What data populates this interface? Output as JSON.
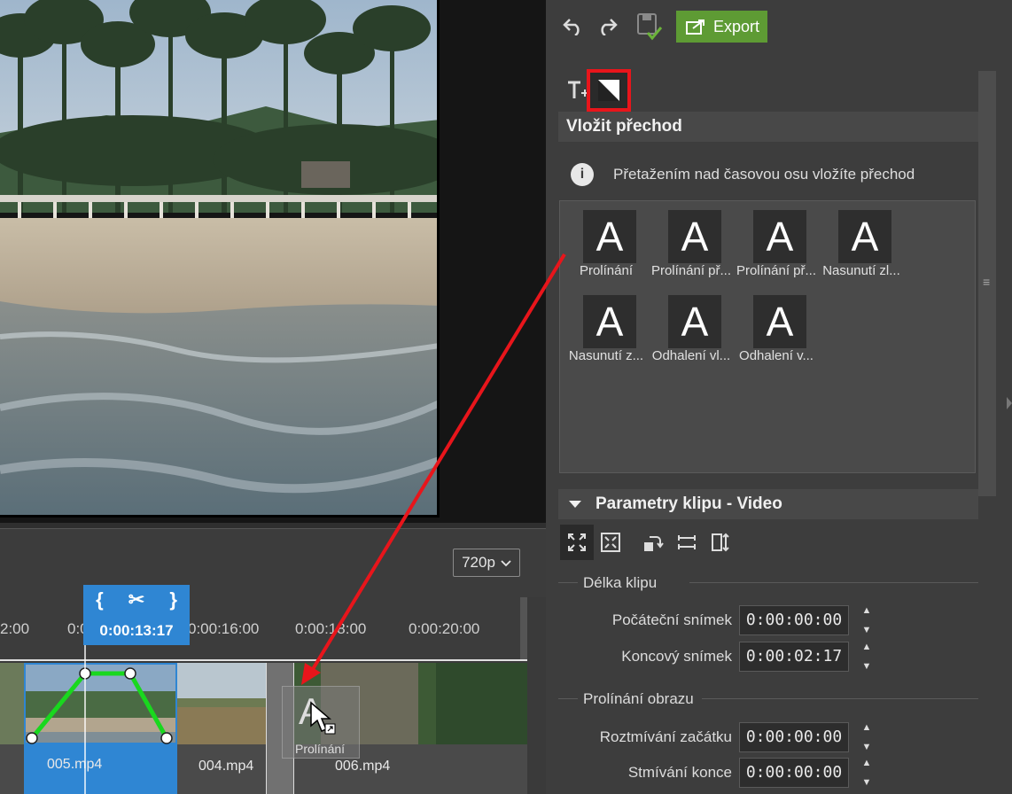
{
  "toolbar": {
    "undo_icon": "undo-icon",
    "redo_icon": "redo-icon",
    "save_icon": "save-check-icon",
    "export_label": "Export"
  },
  "tools": {
    "text_icon": "text-insert-icon",
    "transition_icon": "transition-icon"
  },
  "transitions_panel": {
    "title": "Vložit přechod",
    "info": "Přetažením nad časovou osu vložíte přechod",
    "tiles": [
      {
        "thumb": "A",
        "caption": "Prolínání"
      },
      {
        "thumb": "A",
        "caption": "Prolínání př..."
      },
      {
        "thumb": "A",
        "caption": "Prolínání př..."
      },
      {
        "thumb": "A",
        "caption": "Nasunutí zl..."
      },
      {
        "thumb": "A",
        "caption": "Nasunutí z..."
      },
      {
        "thumb": "A",
        "caption": "Odhalení vl..."
      },
      {
        "thumb": "A",
        "caption": "Odhalení v..."
      }
    ]
  },
  "clip_params": {
    "title": "Parametry klipu - Video",
    "length_section": "Délka klipu",
    "start_label": "Počáteční snímek",
    "start_value": "0:00:00:00",
    "end_label": "Koncový snímek",
    "end_value": "0:00:02:17",
    "blend_section": "Prolínání obrazu",
    "fade_in_label": "Roztmívání začátku",
    "fade_in_value": "0:00:00:00",
    "fade_out_label": "Stmívání konce",
    "fade_out_value": "0:00:00:00"
  },
  "timeline": {
    "resolution": "720p",
    "ticks": [
      "2:00",
      "0:0",
      "0:00:16:00",
      "0:00:18:00",
      "0:00:20:00"
    ],
    "playhead_time": "0:00:13:17",
    "clips": [
      "005.mp4",
      "004.mp4",
      "006.mp4"
    ],
    "drag_label": "Prolínání",
    "drag_thumb": "A"
  },
  "colors": {
    "accent": "#2f86d3",
    "export": "#5e9b34",
    "highlight": "#e8151b",
    "envelope": "#19d81e"
  }
}
